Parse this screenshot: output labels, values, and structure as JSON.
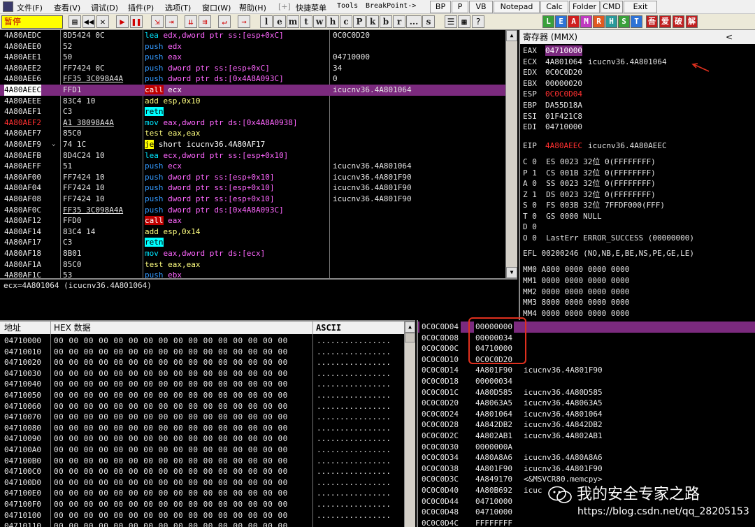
{
  "menu": {
    "items": [
      "文件(F)",
      "查看(V)",
      "调试(D)",
      "插件(P)",
      "选项(T)",
      "窗口(W)",
      "帮助(H)",
      "[+]",
      "快捷菜单",
      "Tools",
      "BreakPoint->"
    ],
    "buttons": [
      "BP",
      "P",
      "VB",
      "Notepad",
      "Calc",
      "Folder",
      "CMD",
      "Exit"
    ]
  },
  "toolbar": {
    "status": "暂停",
    "letters": [
      "l",
      "e",
      "m",
      "t",
      "w",
      "h",
      "c",
      "P",
      "k",
      "b",
      "r",
      "...",
      "s"
    ],
    "colored": [
      "L",
      "E",
      "A",
      "M",
      "R",
      "H",
      "S",
      "T",
      "吾",
      "爱",
      "破",
      "解"
    ]
  },
  "cpu": {
    "rows": [
      {
        "addr": "4A80AEDC",
        "hex": "8D5424 0C",
        "mn": "lea",
        "ops": "edx,dword ptr ss:[esp+0xC]",
        "comment": "0C0C0D20"
      },
      {
        "addr": "4A80AEE0",
        "hex": "52",
        "mn": "push",
        "ops": "edx",
        "comment": ""
      },
      {
        "addr": "4A80AEE1",
        "hex": "50",
        "mn": "push",
        "ops": "eax",
        "comment": "04710000"
      },
      {
        "addr": "4A80AEE2",
        "hex": "FF7424 0C",
        "mn": "push",
        "ops": "dword ptr ss:[esp+0xC]",
        "comment": "34"
      },
      {
        "addr": "4A80AEE6",
        "hex": "FF35 3C098A4A",
        "mn": "push",
        "ops": "dword ptr ds:[0x4A8A093C]",
        "comment": "0"
      },
      {
        "addr": "4A80AEEC",
        "hex": "FFD1",
        "mn": "call",
        "ops": "ecx",
        "comment": "icucnv36.4A801064"
      },
      {
        "addr": "4A80AEEE",
        "hex": "83C4 10",
        "mn": "add",
        "ops": "esp,0x10",
        "comment": ""
      },
      {
        "addr": "4A80AEF1",
        "hex": "C3",
        "mn": "retn",
        "ops": "",
        "comment": ""
      },
      {
        "addr": "4A80AEF2",
        "hex": "A1 38098A4A",
        "mn": "mov",
        "ops": "eax,dword ptr ds:[0x4A8A0938]",
        "comment": ""
      },
      {
        "addr": "4A80AEF7",
        "hex": "85C0",
        "mn": "test",
        "ops": "eax,eax",
        "comment": ""
      },
      {
        "addr": "4A80AEF9",
        "hex": "74 1C",
        "mn": "je",
        "ops": "short icucnv36.4A80AF17",
        "comment": ""
      },
      {
        "addr": "4A80AEFB",
        "hex": "8D4C24 10",
        "mn": "lea",
        "ops": "ecx,dword ptr ss:[esp+0x10]",
        "comment": ""
      },
      {
        "addr": "4A80AEFF",
        "hex": "51",
        "mn": "push",
        "ops": "ecx",
        "comment": "icucnv36.4A801064"
      },
      {
        "addr": "4A80AF00",
        "hex": "FF7424 10",
        "mn": "push",
        "ops": "dword ptr ss:[esp+0x10]",
        "comment": "icucnv36.4A801F90"
      },
      {
        "addr": "4A80AF04",
        "hex": "FF7424 10",
        "mn": "push",
        "ops": "dword ptr ss:[esp+0x10]",
        "comment": "icucnv36.4A801F90"
      },
      {
        "addr": "4A80AF08",
        "hex": "FF7424 10",
        "mn": "push",
        "ops": "dword ptr ss:[esp+0x10]",
        "comment": "icucnv36.4A801F90"
      },
      {
        "addr": "4A80AF0C",
        "hex": "FF35 3C098A4A",
        "mn": "push",
        "ops": "dword ptr ds:[0x4A8A093C]",
        "comment": ""
      },
      {
        "addr": "4A80AF12",
        "hex": "FFD0",
        "mn": "call",
        "ops": "eax",
        "comment": ""
      },
      {
        "addr": "4A80AF14",
        "hex": "83C4 14",
        "mn": "add",
        "ops": "esp,0x14",
        "comment": ""
      },
      {
        "addr": "4A80AF17",
        "hex": "C3",
        "mn": "retn",
        "ops": "",
        "comment": ""
      },
      {
        "addr": "4A80AF18",
        "hex": "8B01",
        "mn": "mov",
        "ops": "eax,dword ptr ds:[ecx]",
        "comment": ""
      },
      {
        "addr": "4A80AF1A",
        "hex": "85C0",
        "mn": "test",
        "ops": "eax,eax",
        "comment": ""
      },
      {
        "addr": "4A80AF1C",
        "hex": "53",
        "mn": "push",
        "ops": "ebx",
        "comment": ""
      }
    ],
    "info": "ecx=4A801064 (icucnv36.4A801064)"
  },
  "registers": {
    "title": "寄存器 (MMX)",
    "gp": [
      {
        "n": "EAX",
        "v": "04710000",
        "c": ""
      },
      {
        "n": "ECX",
        "v": "4A801064",
        "c": "icucnv36.4A801064"
      },
      {
        "n": "EDX",
        "v": "0C0C0D20",
        "c": ""
      },
      {
        "n": "EBX",
        "v": "00000020",
        "c": ""
      },
      {
        "n": "ESP",
        "v": "0C0C0D04",
        "c": ""
      },
      {
        "n": "EBP",
        "v": "DA55D18A",
        "c": ""
      },
      {
        "n": "ESI",
        "v": "01F421C8",
        "c": ""
      },
      {
        "n": "EDI",
        "v": "04710000",
        "c": ""
      }
    ],
    "eip": {
      "n": "EIP",
      "v": "4A80AEEC",
      "c": "icucnv36.4A80AEEC"
    },
    "flags": [
      "C 0  ES 0023 32位 0(FFFFFFFF)",
      "P 1  CS 001B 32位 0(FFFFFFFF)",
      "A 0  SS 0023 32位 0(FFFFFFFF)",
      "Z 1  DS 0023 32位 0(FFFFFFFF)",
      "S 0  FS 003B 32位 7FFDF000(FFF)",
      "T 0  GS 0000 NULL",
      "D 0",
      "O 0  LastErr ERROR_SUCCESS (00000000)"
    ],
    "efl": "EFL 00200246 (NO,NB,E,BE,NS,PE,GE,LE)",
    "mmx": [
      "MM0 A800 0000 0000 0000",
      "MM1 0000 0000 0000 0000",
      "MM2 0000 0000 0000 0000",
      "MM3 8000 0000 0000 0000",
      "MM4 0000 0000 0000 0000"
    ]
  },
  "dump": {
    "col_addr": "地址",
    "col_hex": "HEX 数据",
    "col_ascii": "ASCII",
    "rows": [
      {
        "a": "04710000"
      },
      {
        "a": "04710010"
      },
      {
        "a": "04710020"
      },
      {
        "a": "04710030"
      },
      {
        "a": "04710040"
      },
      {
        "a": "04710050"
      },
      {
        "a": "04710060"
      },
      {
        "a": "04710070"
      },
      {
        "a": "04710080"
      },
      {
        "a": "04710090"
      },
      {
        "a": "047100A0"
      },
      {
        "a": "047100B0"
      },
      {
        "a": "047100C0"
      },
      {
        "a": "047100D0"
      },
      {
        "a": "047100E0"
      },
      {
        "a": "047100F0"
      },
      {
        "a": "04710100"
      },
      {
        "a": "04710110"
      }
    ],
    "hex_line": "00 00 00 00 00 00 00 00 00 00 00 00 00 00 00 00",
    "ascii_line": "................"
  },
  "stack": {
    "rows": [
      {
        "a": "0C0C0D04",
        "v": "00000000",
        "c": ""
      },
      {
        "a": "0C0C0D08",
        "v": "00000034",
        "c": ""
      },
      {
        "a": "0C0C0D0C",
        "v": "04710000",
        "c": ""
      },
      {
        "a": "0C0C0D10",
        "v": "0C0C0D20",
        "c": ""
      },
      {
        "a": "0C0C0D14",
        "v": "4A801F90",
        "c": "icucnv36.4A801F90"
      },
      {
        "a": "0C0C0D18",
        "v": "00000034",
        "c": ""
      },
      {
        "a": "0C0C0D1C",
        "v": "4A80D585",
        "c": "icucnv36.4A80D585"
      },
      {
        "a": "0C0C0D20",
        "v": "4A8063A5",
        "c": "icucnv36.4A8063A5"
      },
      {
        "a": "0C0C0D24",
        "v": "4A801064",
        "c": "icucnv36.4A801064"
      },
      {
        "a": "0C0C0D28",
        "v": "4A842DB2",
        "c": "icucnv36.4A842DB2"
      },
      {
        "a": "0C0C0D2C",
        "v": "4A802AB1",
        "c": "icucnv36.4A802AB1"
      },
      {
        "a": "0C0C0D30",
        "v": "0000000A",
        "c": ""
      },
      {
        "a": "0C0C0D34",
        "v": "4A80A8A6",
        "c": "icucnv36.4A80A8A6"
      },
      {
        "a": "0C0C0D38",
        "v": "4A801F90",
        "c": "icucnv36.4A801F90"
      },
      {
        "a": "0C0C0D3C",
        "v": "4A849170",
        "c": "<&MSVCR80.memcpy>"
      },
      {
        "a": "0C0C0D40",
        "v": "4A80B692",
        "c": "icuc"
      },
      {
        "a": "0C0C0D44",
        "v": "04710000",
        "c": ""
      },
      {
        "a": "0C0C0D48",
        "v": "04710000",
        "c": ""
      },
      {
        "a": "0C0C0D4C",
        "v": "FFFFFFFF",
        "c": ""
      }
    ]
  },
  "watermark": {
    "text": "我的安全专家之路",
    "url": "https://blog.csdn.net/qq_28205153"
  },
  "colors": {
    "selection": "#7b2a7e",
    "highlight_box": "#e0301e",
    "pause_bg": "#ffff00"
  }
}
